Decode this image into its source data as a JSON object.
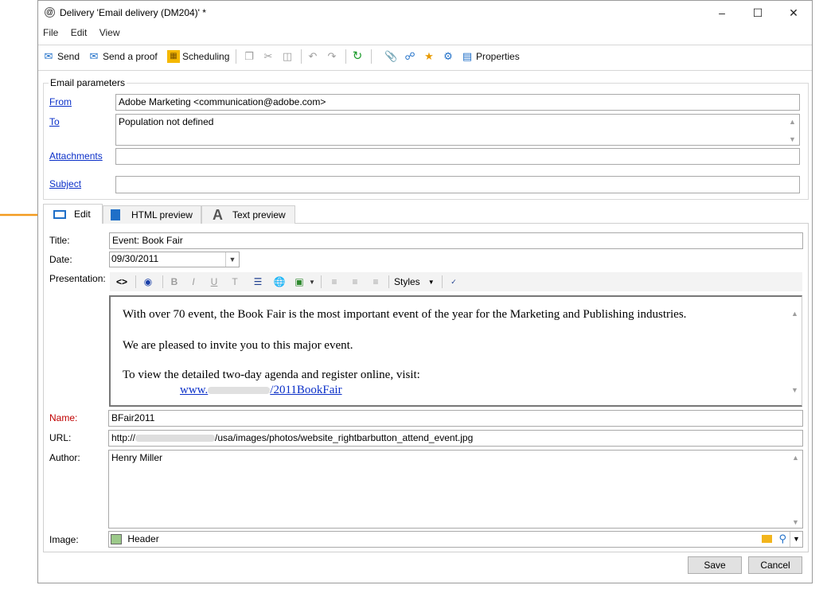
{
  "window": {
    "title": "Delivery 'Email delivery (DM204)' *"
  },
  "menu": [
    "File",
    "Edit",
    "View"
  ],
  "toolbar": {
    "send": "Send",
    "send_proof": "Send a proof",
    "scheduling": "Scheduling",
    "properties": "Properties"
  },
  "email_params": {
    "group_label": "Email parameters",
    "from_label": "From",
    "from_value": "Adobe Marketing <communication@adobe.com>",
    "to_label": "To",
    "to_value": "Population not defined",
    "attachments_label": "Attachments",
    "attachments_value": "",
    "subject_label": "Subject",
    "subject_value": ""
  },
  "tabs": {
    "edit": "Edit",
    "html_preview": "HTML preview",
    "text_preview": "Text preview"
  },
  "form": {
    "title_label": "Title:",
    "title_value": "Event: Book Fair",
    "date_label": "Date:",
    "date_value": "09/30/2011",
    "presentation_label": "Presentation:",
    "styles": "Styles",
    "body": {
      "p1": "With over 70 event, the Book Fair is the most important event of the year for the Marketing and Publishing industries.",
      "p2": "We are pleased to invite you to this major event.",
      "p3": "To view the detailed two-day agenda and register online, visit:",
      "link_prefix": "www.",
      "link_suffix": "/2011BookFair"
    },
    "name_label": "Name:",
    "name_value": "BFair2011",
    "url_label": "URL:",
    "url_prefix": "http://",
    "url_suffix": "/usa/images/photos/website_rightbarbutton_attend_event.jpg",
    "author_label": "Author:",
    "author_value": "Henry Miller",
    "image_label": "Image:",
    "image_value": "Header"
  },
  "buttons": {
    "save": "Save",
    "cancel": "Cancel"
  },
  "colors": {
    "link": "#0a2fc8",
    "name_label": "#c00000",
    "arrow": "#f39a1e",
    "accent_blue": "#1f6fc8"
  }
}
